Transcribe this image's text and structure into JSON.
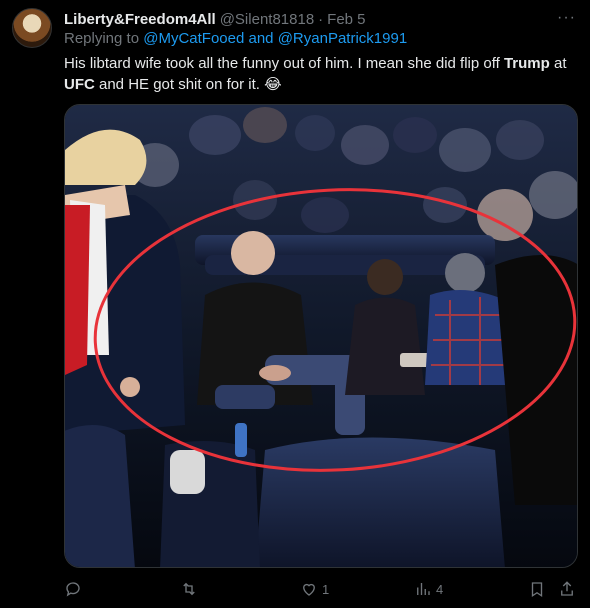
{
  "tweet": {
    "display_name": "Liberty&Freedom4All",
    "handle": "@Silent81818",
    "separator": "·",
    "date": "Feb 5",
    "more_label": "···",
    "replying_prefix": "Replying to",
    "replying_user1": "@MyCatFooed",
    "replying_and": "and",
    "replying_user2": "@RyanPatrick1991",
    "text_part1": "His libtard wife took all the funny out of him. I mean she did flip off",
    "text_bold1": "Trump",
    "text_part2": "at",
    "text_bold2": "UFC",
    "text_part3": "and HE got shit on for it.",
    "emoji": "😂"
  },
  "actions": {
    "reply_count": "",
    "retweet_count": "",
    "like_count": "1",
    "views_count": "4"
  },
  "colors": {
    "background": "#000000",
    "text": "#e7e9ea",
    "muted": "#71767b",
    "link": "#1d9bf0",
    "annotation_circle": "#e8333a"
  },
  "icons": [
    "reply-icon",
    "retweet-icon",
    "like-icon",
    "views-icon",
    "bookmark-icon",
    "share-icon",
    "more-icon"
  ]
}
